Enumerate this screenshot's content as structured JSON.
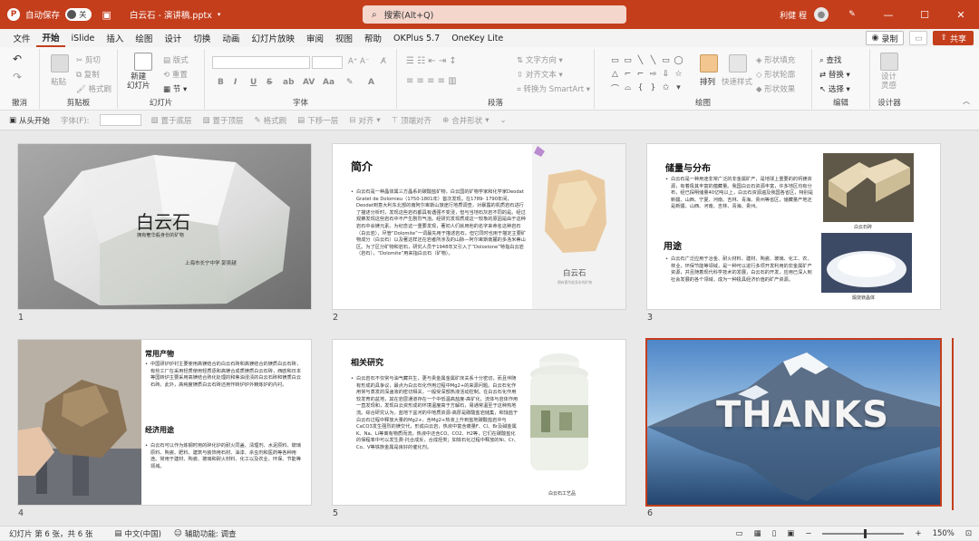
{
  "titlebar": {
    "autosave_label": "自动保存",
    "autosave_state": "关",
    "file_name": "白云石 - 演讲稿.pptx",
    "search_placeholder": "搜索(Alt+Q)",
    "user_name": "利健 程",
    "brand_color": "#c43e1c"
  },
  "menu": {
    "tabs": [
      "文件",
      "开始",
      "iSlide",
      "插入",
      "绘图",
      "设计",
      "切换",
      "动画",
      "幻灯片放映",
      "审阅",
      "视图",
      "帮助",
      "OKPlus 5.7",
      "OneKey Lite"
    ],
    "active_tab": "开始",
    "record_label": "录制",
    "share_label": "共享"
  },
  "ribbon": {
    "groups": {
      "undo": "撤消",
      "clipboard": "剪贴板",
      "slides": "幻灯片",
      "font": "字体",
      "paragraph": "段落",
      "drawing": "绘图",
      "editing": "编辑",
      "designer": "设计器"
    },
    "clipboard": {
      "paste": "粘贴",
      "cut": "剪切",
      "copy": "复制",
      "format_painter": "格式刷"
    },
    "slides": {
      "new_slide": "新建\n幻灯片",
      "layout": "版式",
      "reset": "重置",
      "section": "节"
    },
    "paragraph": {
      "text_direction": "文字方向",
      "align_text": "对齐文本",
      "convert_smartart": "转换为 SmartArt"
    },
    "drawing": {
      "arrange": "排列",
      "quick_styles": "快速样式",
      "shape_fill": "形状填充",
      "shape_outline": "形状轮廓",
      "shape_effects": "形状效果"
    },
    "editing": {
      "find": "查找",
      "replace": "替换",
      "select": "选择"
    },
    "designer": {
      "design_ideas": "设计\n灵感"
    }
  },
  "subtoolbar": {
    "items": [
      "从头开始",
      "字体(F):",
      "置于底层",
      "置于顶层",
      "格式刷",
      "下移一层",
      "对齐",
      "顶端对齐",
      "合并形状"
    ]
  },
  "slides": [
    {
      "number": "1",
      "title": "白云石",
      "subtitle": "拥有奢华般身份的矿物",
      "author": "上海市长宁中学  郭吴越"
    },
    {
      "number": "2",
      "title": "简介",
      "body": "白云石是一种晶体属三方晶系的碳酸盐矿物，白云国的矿物学家和化学家Deodat Gratet de Dolomieu（1750-1801年）首次发现。在1789- 1790年间，Deodat到意大利东北部的南阿尔卑斯山旅途行地质调查，对暴露的机质岩石进行了描述分析时，发现这些岩石都具有遇强不变浸，但与当地石灰岩不同的是。经过观察发现这些岩石中不产生剧烈气泡。经研究发现质成这一较象的原因是由于这种岩石中会镁元素。为纪念这一重要发现，著初人们就用他的名字来命名这种岩石（白云岩），尽管“Dolomite”一词最先用于描述岩石，但它同时也用于描定主要矿物成分（白云石）以及著这样还在岩者所涉及的山脉—阿尔卑斯南麓的多洛米蒂山区。为了区分矿物和岩石，研究人员于1948年又引入了“Dolostone”特指白云岩（岩石），“Dolomite”用来指白云石（矿物）。",
      "book_title": "白云石",
      "book_subtitle": "拥有奢华般身份的矿物"
    },
    {
      "number": "3",
      "title1": "储量与分布",
      "body1": "白云石是一种用途非常广泛的非金属矿产，是地球上重要的的钙镁资源，有着极其丰富的蕴藏量。我国白云石资源丰富，许多地区均有分布，经已探明储量40亿吨以上，白云石资源遍及我国各省区，特别是新疆、山西、宁夏、河南、吉林、青海、贵州等省区，储藏量产地还是新疆、山西、河南、吉林、青海、贵州。",
      "caption1": "白云石砖",
      "title2": "用途",
      "body2": "白云石广泛应用于冶金、耐火材料、建材、陶瓷、玻璃、化工、农、林业，环保节能等领域，是一种可以进行多项开发利用的非金属矿产资源，并且随着现代科学技术的发展，白云石的开发，应用已深入到社会发展的各个领域，成为一种极具经济价值的矿产资源。",
      "caption2": "煅烧镁晶体"
    },
    {
      "number": "4",
      "title1": "常用产物",
      "body1": "中国研炉炉衬主要使用高镁结合的白云石砖和高镁结合的镁质白云石砖，有些工厂在采用轻质使用轻质逐和高镁合成质镁质白云石砖，西欧和日本等国转炉主要采用高镁结合熟化处理的和焦油浸渍的白云石砖和镁质白云石砖。此外，高纯度镁质白云石砖还用作转炉炉外精炼炉的内衬。",
      "title2": "经济用途",
      "body2": "白云石可以作为炼钢时用的碎化炉的耐火同盖、清理剂、水泥原料、玻璃原料、陶瓷、肥料、建筑与装饰用石材、油漆、杀虫剂和医药等各种用途。常用于建材、陶瓷、玻璃和耐火材料、化工以及农业、环保、节能等领域。"
    },
    {
      "number": "5",
      "title": "相关研究",
      "body": "白云岩石不仅常与油气藏共生，更与贵金属金属矿床关系十分密切，而且伴随有形成的具争议，最点为白云石化作用过程中Mg2+的来源问题。白云石化作用常与蒸发的深卤液的密切相关，一般受深部热液活动控制。在白云石化作用较发育的盆地，其在岩层通道存在一个中低温高盐度-高矿化、流体与岩体作用一直发现和，发现白云资形成的环境温度高于方解石，易通常温至于这种热地流。综合研究认为，盐地下盆河的中地质资源-高厚是碳酸盐岩储集，和蚀盐于白云石过程中释放大量的Mg2+，含Mg2+热液上升到盐地碳酸盐岩中与CaCO3发生强烈的镁交代，形成白云岩，热液中富含痛量F、Cl、Br及碱金属K、Na、Li等离有物质而流，热液中还含CO、CO2、H2等，它们在碳酸盐化的保程率中可以发生费-托合成反，合成烃类；如铁石化过程中释放的Ni、Cr、Co、V等铁族金属是良好的催化剂。",
      "caption": "白云石工艺品"
    },
    {
      "number": "6",
      "title": "THANKS"
    }
  ],
  "statusbar": {
    "slide_info": "幻灯片 第 6 张，共 6 张",
    "language": "中文(中国)",
    "accessibility": "辅助功能: 调查",
    "zoom": "150%"
  }
}
